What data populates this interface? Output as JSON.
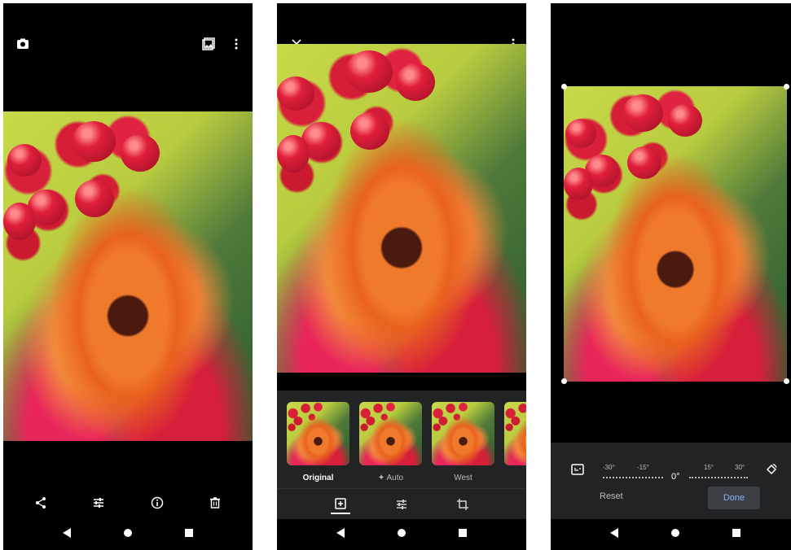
{
  "screen1": {
    "top_icons": [
      "camera-switch-icon",
      "gallery-icon",
      "more-vert-icon"
    ],
    "bottom_actions": [
      {
        "name": "share-icon",
        "glyph": "<"
      },
      {
        "name": "edit-adjust-icon",
        "glyph": "⇌"
      },
      {
        "name": "info-icon",
        "glyph": "ⓘ"
      },
      {
        "name": "delete-icon",
        "glyph": "🗑"
      }
    ]
  },
  "screen2": {
    "top_icons": [
      "close-icon",
      "more-vert-icon"
    ],
    "filters": [
      {
        "label": "Original",
        "selected": true
      },
      {
        "label": "Auto",
        "selected": false,
        "prefix_icon": "sparkle-icon"
      },
      {
        "label": "West",
        "selected": false
      },
      {
        "label": "",
        "selected": false
      }
    ],
    "tools": [
      {
        "name": "filters-tool-icon",
        "active": true
      },
      {
        "name": "adjust-tool-icon",
        "active": false
      },
      {
        "name": "crop-rotate-tool-icon",
        "active": false
      }
    ]
  },
  "screen3": {
    "rotation": {
      "ticks_left": [
        "-30°",
        "-15°"
      ],
      "zero": "0°",
      "ticks_right": [
        "15°",
        "30°"
      ]
    },
    "reset_label": "Reset",
    "done_label": "Done"
  },
  "nav": {
    "icons": [
      "back-icon",
      "home-icon",
      "recents-icon"
    ]
  },
  "colors": {
    "background": "#000000",
    "panel": "#222324",
    "done_text": "#8ab4f8"
  }
}
